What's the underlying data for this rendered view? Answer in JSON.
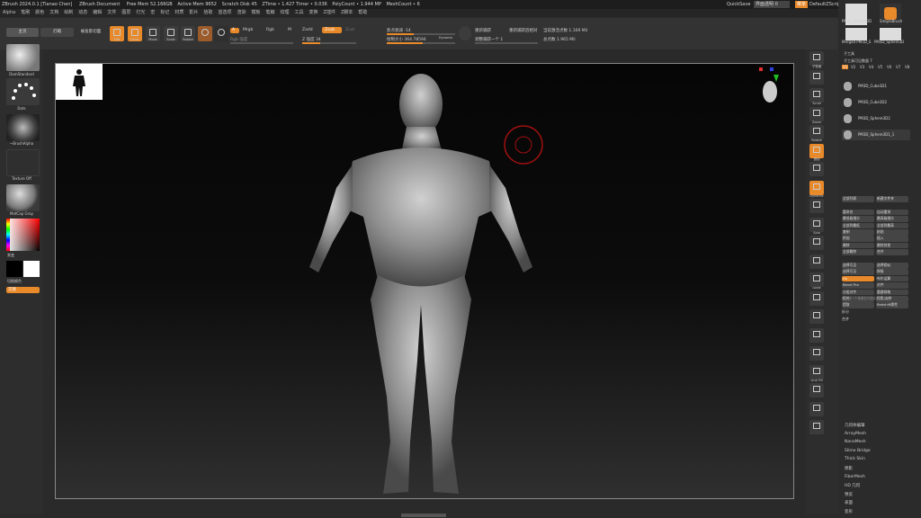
{
  "title_bar": {
    "app": "ZBrush 2024.0.1 [Tianao Chen]",
    "document": "ZBrush Document",
    "stats": [
      "Free Mem 52.166GB",
      "Active Mem 9652",
      "Scratch Disk 45",
      "ZTime • 1.427 Timer • 0.036",
      "PolyCount • 1.944 MP",
      "MeshCount • 6"
    ],
    "quicksave": "QuickSave",
    "transparency": "界面透明 0",
    "menu_btn": "菜单",
    "script": "DefaultZScript"
  },
  "menu": [
    "Alpha",
    "笔刷",
    "颜色",
    "文档",
    "绘制",
    "动态",
    "编辑",
    "文件",
    "图层",
    "灯光",
    "宏",
    "标记",
    "材质",
    "影片",
    "拾取",
    "首选项",
    "渲染",
    "模板",
    "笔触",
    "纹理",
    "工具",
    "变换",
    "Z插件",
    "Z脚本",
    "帮助"
  ],
  "toolbar": {
    "home": "主页",
    "lightbox": "灯箱",
    "projection": "被投影切面",
    "draw_tools": [
      "Edit",
      "Draw",
      "Move",
      "Scale",
      "Rotate"
    ],
    "a_label": "A",
    "mrgb": "Mrgb",
    "rgb": "Rgb",
    "m": "M",
    "zadd": "Zadd",
    "zsub": "Zsub",
    "zcut": "Zcut",
    "rgb_intensity": "Rgb 强度",
    "z_intensity": "Z 强度 34",
    "focal": "焦点衰减 -14",
    "draw_size": "绘制大小 364.78594",
    "dynamic": "Dynamic",
    "a1": "重新捕获",
    "a2": "重新捕获后相对",
    "a3": "调整捕获一个 1",
    "active_points": "当前激活点数 1.169 Mil",
    "total_points": "总点数 1.965 Mil"
  },
  "left_panel": {
    "brush": "DamStandard",
    "stroke": "Dots",
    "alpha": "~BrushAlpha",
    "texture": "Texture Off",
    "material": "MatCap Gray",
    "gradient": "渐变",
    "switch_color": "切换颜色",
    "swap": "交替"
  },
  "right_shelf": [
    "子笔刷",
    "",
    "Scroll",
    "Zoom",
    "Rotate",
    "透视",
    "",
    "Dynamic",
    "",
    "Solo",
    "",
    "",
    "Local",
    "",
    "",
    "",
    "",
    "Line Fill",
    "",
    "",
    ""
  ],
  "right_panel": {
    "subtool_title": "子工具",
    "visible_count": "子工具可见数量 7",
    "versions": [
      "V1",
      "V2",
      "V3",
      "V4",
      "V5",
      "V6",
      "V7",
      "V8"
    ],
    "subtools": [
      "PM3D_Cube3D1",
      "PM3D_Cube3D2",
      "PM3D_Sphere3D2",
      "PM3D_Sphere3D1_1"
    ],
    "thumbs": [
      "PM3D_Sphere3D",
      "SimpleBrush",
      "Merged PM3D_S",
      "PM3D_Sphere3D"
    ],
    "ops": [
      "全部列表",
      "新建文件夹",
      "",
      "",
      "重命名",
      "自动重排",
      "最低级细分",
      "最高级细分",
      "全部到最低",
      "全部到最高",
      "复制",
      "粘贴",
      "附加",
      "插入",
      "删除",
      "删除其他",
      "全部删除",
      "合并",
      "",
      "",
      "选择可见",
      "选择相似",
      "选择可见",
      "焊接",
      "Uv",
      "布尔运算",
      "Bevel Pro",
      "对齐",
      "分组对齐",
      "重建网格",
      "投射",
      "投影/去挤",
      "提取",
      "Redshift属性"
    ],
    "hint": "单击或一个像素在列表中的子工具",
    "split": "拆分",
    "merge": "合并",
    "geometry": [
      "几何体编辑",
      "ArrayMesh",
      "NanoMesh",
      "Slime Bridge",
      "Thick Skin",
      "阴影",
      "FiberMesh",
      "HD 几何",
      "预览",
      "表面",
      "变形"
    ]
  }
}
